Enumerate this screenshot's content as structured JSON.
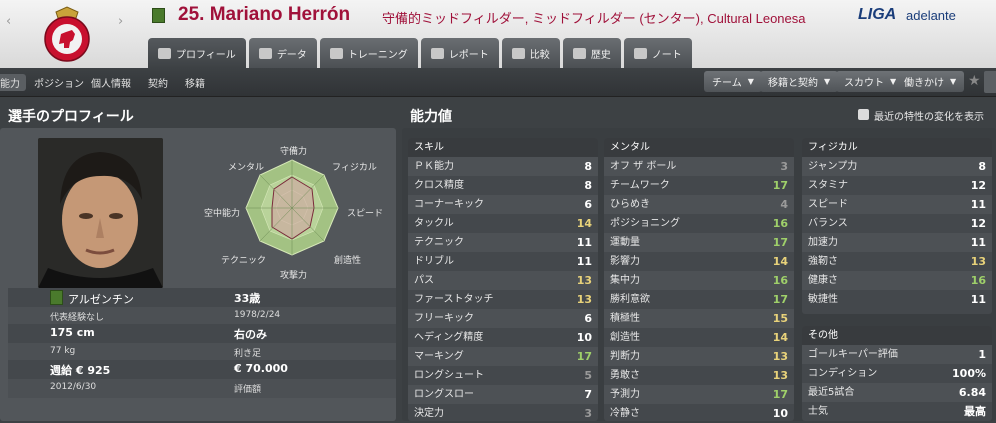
{
  "header": {
    "player_title": "25. Mariano Herrón",
    "player_sub": "守備的ミッドフィルダー, ミッドフィルダー (センター), Cultural Leonesa",
    "league_logo_text1": "LIGA",
    "league_logo_text2": "adelante",
    "nav_back": "‹",
    "nav_forward": "›"
  },
  "tabs": [
    {
      "label": "プロフィール",
      "icon": "profile-icon"
    },
    {
      "label": "データ",
      "icon": "data-icon"
    },
    {
      "label": "トレーニング",
      "icon": "training-icon"
    },
    {
      "label": "レポート",
      "icon": "report-icon"
    },
    {
      "label": "比較",
      "icon": "compare-icon"
    },
    {
      "label": "歴史",
      "icon": "history-icon"
    },
    {
      "label": "ノート",
      "icon": "note-icon"
    }
  ],
  "subtabs": [
    "能力",
    "ポジション",
    "個人情報",
    "契約",
    "移籍"
  ],
  "actions": [
    "チーム",
    "移籍と契約",
    "スカウト",
    "働きかけ"
  ],
  "profile": {
    "section_title": "選手のプロフィール",
    "nationality": "アルゼンチン",
    "intl_caps": "代表経験なし",
    "age": "33歳",
    "birth_date": "1978/2/24",
    "height": "175 cm",
    "foot": "右のみ",
    "weight": "77 kg",
    "foot_label": "利き足",
    "wage": "週給 € 925",
    "value": "€ 70.000",
    "contract_end": "2012/6/30",
    "value_label": "評価額"
  },
  "radar": {
    "labels": [
      "守備力",
      "フィジカル",
      "スピード",
      "創造性",
      "攻撃力",
      "テクニック",
      "空中能力",
      "メンタル"
    ]
  },
  "attributes": {
    "section_title": "能力値",
    "show_changes_label": "最近の特性の変化を表示",
    "skill": {
      "title": "スキル",
      "rows": [
        {
          "name": "ＰＫ能力",
          "value": "8"
        },
        {
          "name": "クロス精度",
          "value": "8"
        },
        {
          "name": "コーナーキック",
          "value": "6"
        },
        {
          "name": "タックル",
          "value": "14"
        },
        {
          "name": "テクニック",
          "value": "11"
        },
        {
          "name": "ドリブル",
          "value": "11"
        },
        {
          "name": "パス",
          "value": "13"
        },
        {
          "name": "ファーストタッチ",
          "value": "13"
        },
        {
          "name": "フリーキック",
          "value": "6"
        },
        {
          "name": "ヘディング精度",
          "value": "10"
        },
        {
          "name": "マーキング",
          "value": "17"
        },
        {
          "name": "ロングシュート",
          "value": "5"
        },
        {
          "name": "ロングスロー",
          "value": "7"
        },
        {
          "name": "決定力",
          "value": "3"
        }
      ]
    },
    "mental": {
      "title": "メンタル",
      "rows": [
        {
          "name": "オフ ザ ボール",
          "value": "3"
        },
        {
          "name": "チームワーク",
          "value": "17"
        },
        {
          "name": "ひらめき",
          "value": "4"
        },
        {
          "name": "ポジショニング",
          "value": "16"
        },
        {
          "name": "運動量",
          "value": "17"
        },
        {
          "name": "影響力",
          "value": "14"
        },
        {
          "name": "集中力",
          "value": "16"
        },
        {
          "name": "勝利意欲",
          "value": "17"
        },
        {
          "name": "積極性",
          "value": "15"
        },
        {
          "name": "創造性",
          "value": "14"
        },
        {
          "name": "判断力",
          "value": "13"
        },
        {
          "name": "勇敢さ",
          "value": "13"
        },
        {
          "name": "予測力",
          "value": "17"
        },
        {
          "name": "冷静さ",
          "value": "10"
        }
      ]
    },
    "physical": {
      "title": "フィジカル",
      "rows": [
        {
          "name": "ジャンプ力",
          "value": "8"
        },
        {
          "name": "スタミナ",
          "value": "12"
        },
        {
          "name": "スピード",
          "value": "11"
        },
        {
          "name": "バランス",
          "value": "12"
        },
        {
          "name": "加速力",
          "value": "11"
        },
        {
          "name": "強靭さ",
          "value": "13"
        },
        {
          "name": "健康さ",
          "value": "16"
        },
        {
          "name": "敏捷性",
          "value": "11"
        }
      ]
    },
    "other": {
      "title": "その他",
      "rows": [
        {
          "name": "ゴールキーパー評価",
          "value": "1"
        },
        {
          "name": "コンディション",
          "value": "100%"
        },
        {
          "name": "最近5試合",
          "value": "6.84"
        },
        {
          "name": "士気",
          "value": "最高"
        }
      ]
    }
  }
}
